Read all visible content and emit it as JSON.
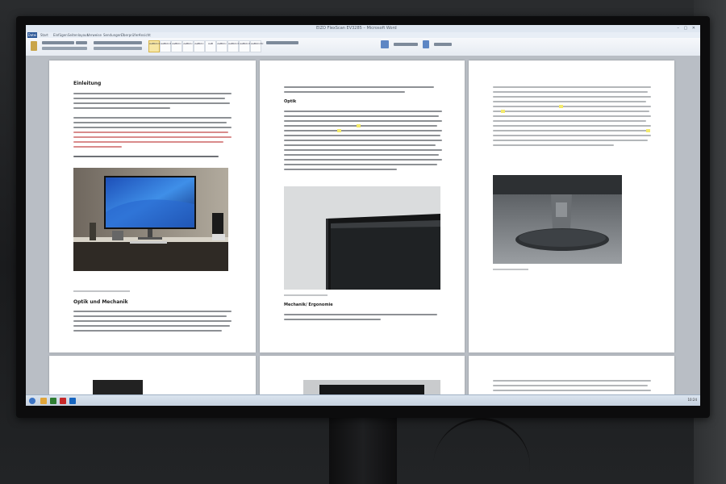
{
  "window": {
    "title": "EIZO FlexScan EV3285 – Microsoft Word",
    "controls": "– ▢ ✕"
  },
  "ribbon": {
    "file_tab": "Datei",
    "tabs": [
      "Start",
      "Einfügen",
      "Seitenlayout",
      "Verweise",
      "Sendungen",
      "Überprüfen",
      "Ansicht"
    ],
    "styles": [
      "AaBbCcDc",
      "AaBbCcDc",
      "AaBbCc",
      "AaBbCc",
      "AaBbCc",
      "AaB",
      "AaBbCc",
      "AaBbCcDc",
      "AaBbCcDc",
      "AaBbCcDc"
    ]
  },
  "pages": {
    "p1": {
      "heading": "Einleitung",
      "section_heading": "Optik und Mechanik"
    },
    "p2": {
      "heading_optik": "Optik",
      "heading_mechanik": "Mechanik/ Ergonomie"
    }
  },
  "taskbar": {
    "clock": "10:24"
  },
  "colors": {
    "highlight": "#f3ea6b",
    "red_text": "#d98b8b",
    "ribbon_file": "#2b5797"
  }
}
